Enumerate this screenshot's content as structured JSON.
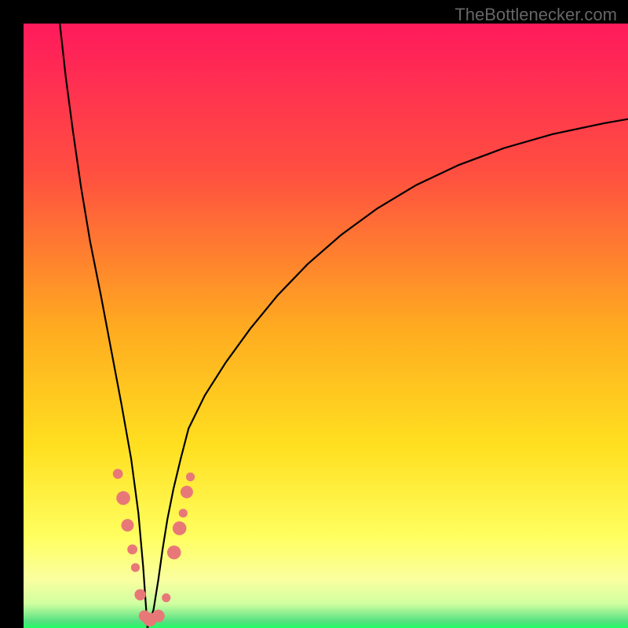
{
  "watermark": "TheBottlenecker.com",
  "chart_data": {
    "type": "line",
    "title": "",
    "xlabel": "",
    "ylabel": "",
    "xlim": [
      0,
      100
    ],
    "ylim": [
      0,
      100
    ],
    "gradient_stops": [
      {
        "offset": 0,
        "color": "#ff1a5c"
      },
      {
        "offset": 0.25,
        "color": "#ff5040"
      },
      {
        "offset": 0.5,
        "color": "#ffaa20"
      },
      {
        "offset": 0.7,
        "color": "#ffe020"
      },
      {
        "offset": 0.85,
        "color": "#ffff60"
      },
      {
        "offset": 0.92,
        "color": "#faffa0"
      },
      {
        "offset": 0.96,
        "color": "#d0ffa0"
      },
      {
        "offset": 0.99,
        "color": "#50e080"
      },
      {
        "offset": 1.0,
        "color": "#20ff60"
      }
    ],
    "curve_left": {
      "x": [
        6.0,
        7.0,
        8.2,
        9.5,
        11.0,
        12.8,
        14.5,
        16.2,
        17.8,
        19.0,
        19.8,
        20.5
      ],
      "y": [
        100,
        91,
        82,
        73,
        64,
        55,
        46,
        37,
        28,
        19,
        10,
        0
      ]
    },
    "curve_right_valley": {
      "x": [
        20.5,
        21.5,
        22.3,
        23.0,
        23.8,
        24.8,
        26.0,
        27.3
      ],
      "y": [
        0,
        3,
        8,
        13,
        18,
        23,
        28,
        33
      ]
    },
    "curve_right_rise": {
      "x": [
        27.3,
        30.0,
        33.5,
        37.5,
        42.0,
        47.0,
        52.5,
        58.5,
        65.0,
        72.0,
        79.5,
        87.5,
        96.0,
        100.0
      ],
      "y": [
        33,
        38.5,
        44,
        49.5,
        55,
        60.2,
        65.0,
        69.4,
        73.3,
        76.6,
        79.4,
        81.7,
        83.5,
        84.2
      ]
    },
    "dots": [
      {
        "x": 15.6,
        "y": 25.5,
        "r": 4.0
      },
      {
        "x": 16.5,
        "y": 21.5,
        "r": 5.5
      },
      {
        "x": 17.2,
        "y": 17.0,
        "r": 5.0
      },
      {
        "x": 18.0,
        "y": 13.0,
        "r": 4.0
      },
      {
        "x": 18.5,
        "y": 10.0,
        "r": 3.5
      },
      {
        "x": 19.3,
        "y": 5.5,
        "r": 4.5
      },
      {
        "x": 20.0,
        "y": 2.0,
        "r": 4.5
      },
      {
        "x": 20.9,
        "y": 1.4,
        "r": 5.5
      },
      {
        "x": 22.3,
        "y": 2.0,
        "r": 5.0
      },
      {
        "x": 23.6,
        "y": 5.0,
        "r": 3.5
      },
      {
        "x": 24.9,
        "y": 12.5,
        "r": 5.5
      },
      {
        "x": 25.8,
        "y": 16.5,
        "r": 5.5
      },
      {
        "x": 26.4,
        "y": 19.0,
        "r": 3.5
      },
      {
        "x": 27.0,
        "y": 22.5,
        "r": 5.0
      },
      {
        "x": 27.6,
        "y": 25.0,
        "r": 3.5
      }
    ],
    "dot_color": "#e87878"
  }
}
